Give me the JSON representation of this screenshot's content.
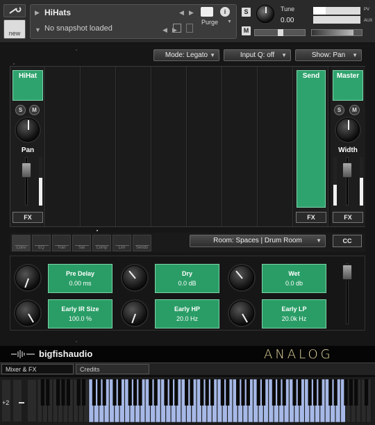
{
  "header": {
    "instrument_name": "HiHats",
    "snapshot": "No snapshot loaded",
    "purge_label": "Purge",
    "new_label": "new",
    "solo": "S",
    "mute": "M",
    "tune_label": "Tune",
    "tune_value": "0.00",
    "aux_label": "AUX",
    "pv_label": "PV"
  },
  "toolbar": {
    "mode": "Mode: Legato",
    "input_q": "Input Q: off",
    "show": "Show: Pan"
  },
  "mixer": {
    "channel_name": "HiHat",
    "send_label": "Send",
    "master_label": "Master",
    "solo": "S",
    "mute": "M",
    "pan_label": "Pan",
    "width_label": "Width",
    "fx_label": "FX"
  },
  "fx": {
    "tabs": [
      "Conv",
      "EQ",
      "Tran",
      "Sat",
      "Comp",
      "Lim",
      "Sends"
    ],
    "room_select": "Room: Spaces | Drum Room",
    "cc_label": "CC",
    "params": [
      {
        "name": "Pre Delay",
        "value": "0.00 ms"
      },
      {
        "name": "Dry",
        "value": "0.0 dB"
      },
      {
        "name": "Wet",
        "value": "0.0 db"
      },
      {
        "name": "Early IR Size",
        "value": "100.0 %"
      },
      {
        "name": "Early HP",
        "value": "20.0 Hz"
      },
      {
        "name": "Early LP",
        "value": "20.0k Hz"
      }
    ]
  },
  "footer": {
    "brand": "bigfishaudio",
    "product": "ANALOG EDM",
    "tab_mixer": "Mixer & FX",
    "tab_credits": "Credits",
    "octave": "+2"
  },
  "colors": {
    "accent_green": "#2fa36e",
    "key_highlight": "#a6b8e6",
    "product_logo": "#e8d9a2"
  }
}
